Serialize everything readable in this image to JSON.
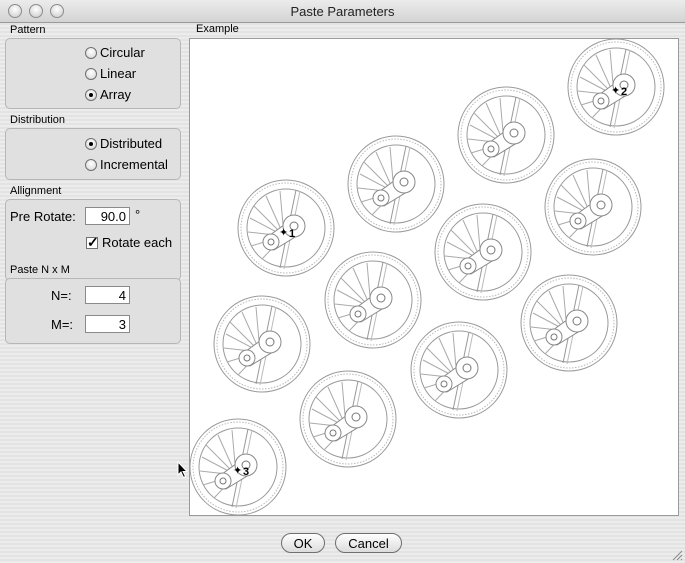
{
  "window": {
    "title": "Paste Parameters"
  },
  "pattern": {
    "title": "Pattern",
    "options": [
      {
        "label": "Circular",
        "selected": false
      },
      {
        "label": "Linear",
        "selected": false
      },
      {
        "label": "Array",
        "selected": true
      }
    ]
  },
  "distribution": {
    "title": "Distribution",
    "options": [
      {
        "label": "Distributed",
        "selected": true
      },
      {
        "label": "Incremental",
        "selected": false
      }
    ]
  },
  "alignment": {
    "title": "Allignment",
    "pre_rotate_label": "Pre Rotate:",
    "pre_rotate_value": "90.0",
    "degree_symbol": "°",
    "rotate_each_label": "Rotate each",
    "rotate_each_checked": true
  },
  "paste_nxm": {
    "title": "Paste N x M",
    "n_label": "N=:",
    "n_value": "4",
    "m_label": "M=:",
    "m_value": "3"
  },
  "example": {
    "title": "Example",
    "markers": [
      "1",
      "2",
      "3"
    ]
  },
  "buttons": {
    "ok": "OK",
    "cancel": "Cancel"
  }
}
